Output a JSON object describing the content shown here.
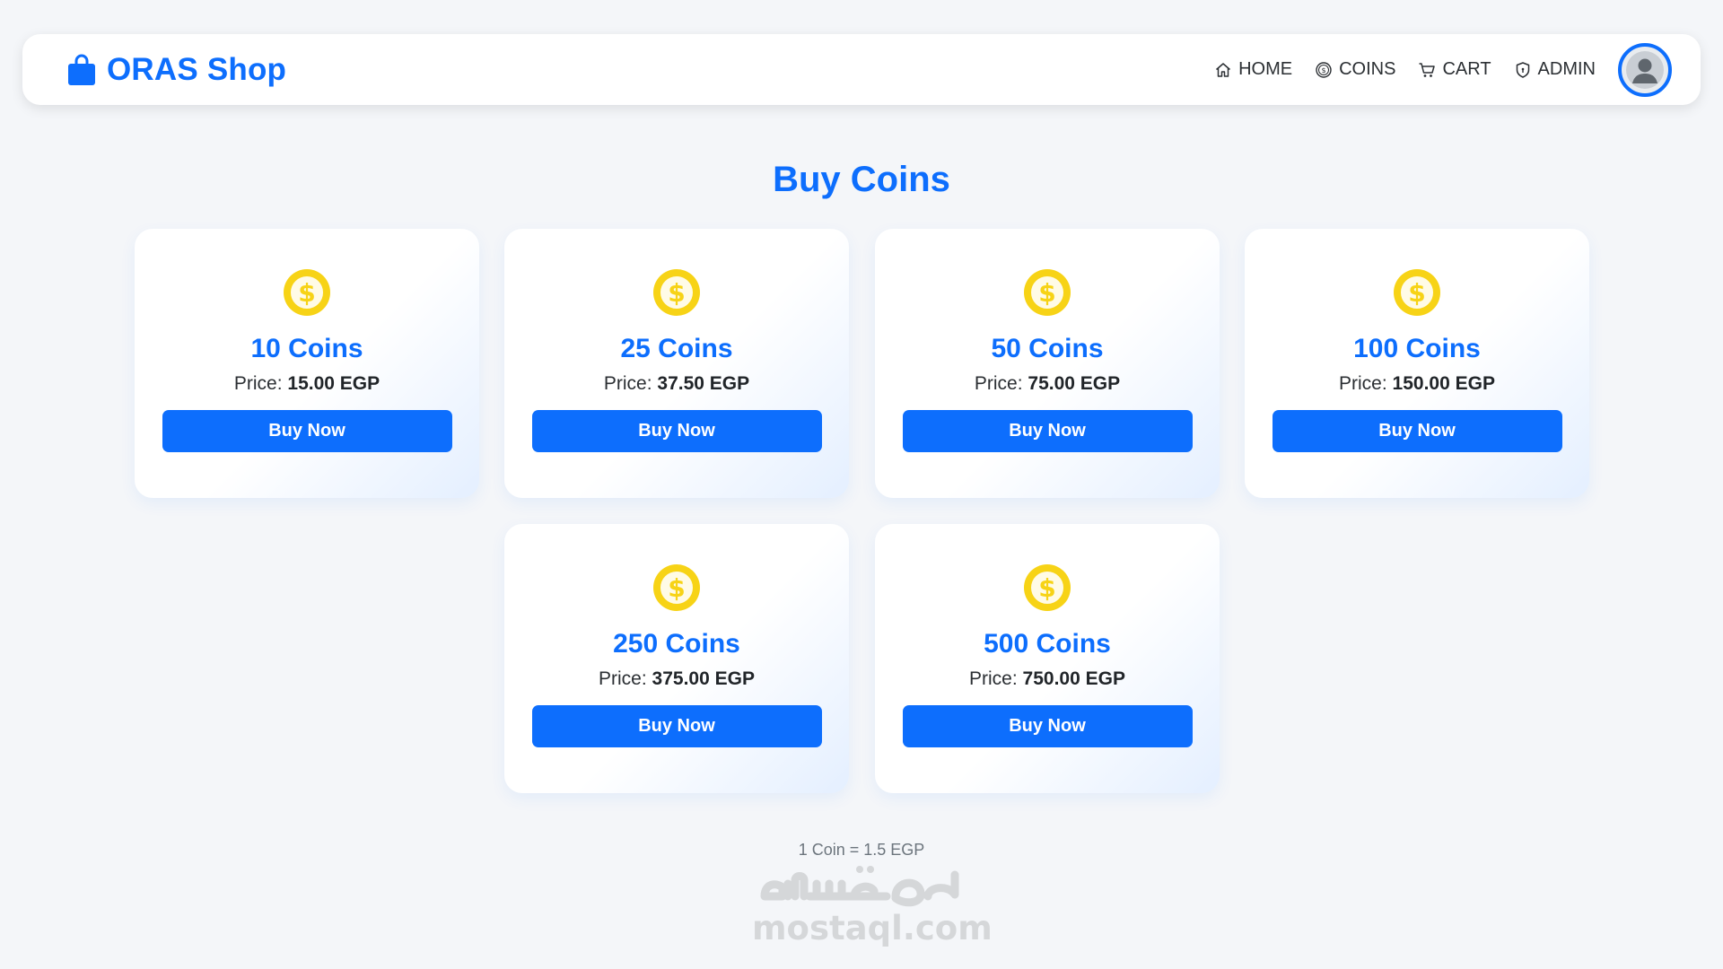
{
  "navbar": {
    "brand": "ORAS Shop",
    "links": [
      {
        "label": "HOME",
        "icon": "house-icon"
      },
      {
        "label": "COINS",
        "icon": "coin-icon"
      },
      {
        "label": "CART",
        "icon": "cart-icon"
      },
      {
        "label": "ADMIN",
        "icon": "shield-icon"
      }
    ],
    "avatar_icon": "user-avatar-icon"
  },
  "page": {
    "title": "Buy Coins"
  },
  "packages": [
    {
      "coins": "10 Coins",
      "price_label": "Price:",
      "price": "15.00 EGP",
      "button": "Buy Now"
    },
    {
      "coins": "25 Coins",
      "price_label": "Price:",
      "price": "37.50 EGP",
      "button": "Buy Now"
    },
    {
      "coins": "50 Coins",
      "price_label": "Price:",
      "price": "75.00 EGP",
      "button": "Buy Now"
    },
    {
      "coins": "100 Coins",
      "price_label": "Price:",
      "price": "150.00 EGP",
      "button": "Buy Now"
    },
    {
      "coins": "250 Coins",
      "price_label": "Price:",
      "price": "375.00 EGP",
      "button": "Buy Now"
    },
    {
      "coins": "500 Coins",
      "price_label": "Price:",
      "price": "750.00 EGP",
      "button": "Buy Now"
    }
  ],
  "footer": {
    "rate": "1 Coin = 1.5 EGP"
  },
  "watermark": {
    "arabic": "مستقل",
    "latin": "mostaql.com"
  },
  "colors": {
    "primary": "#0d6efd",
    "coin": "#f7d316",
    "background": "#f4f6f9"
  }
}
